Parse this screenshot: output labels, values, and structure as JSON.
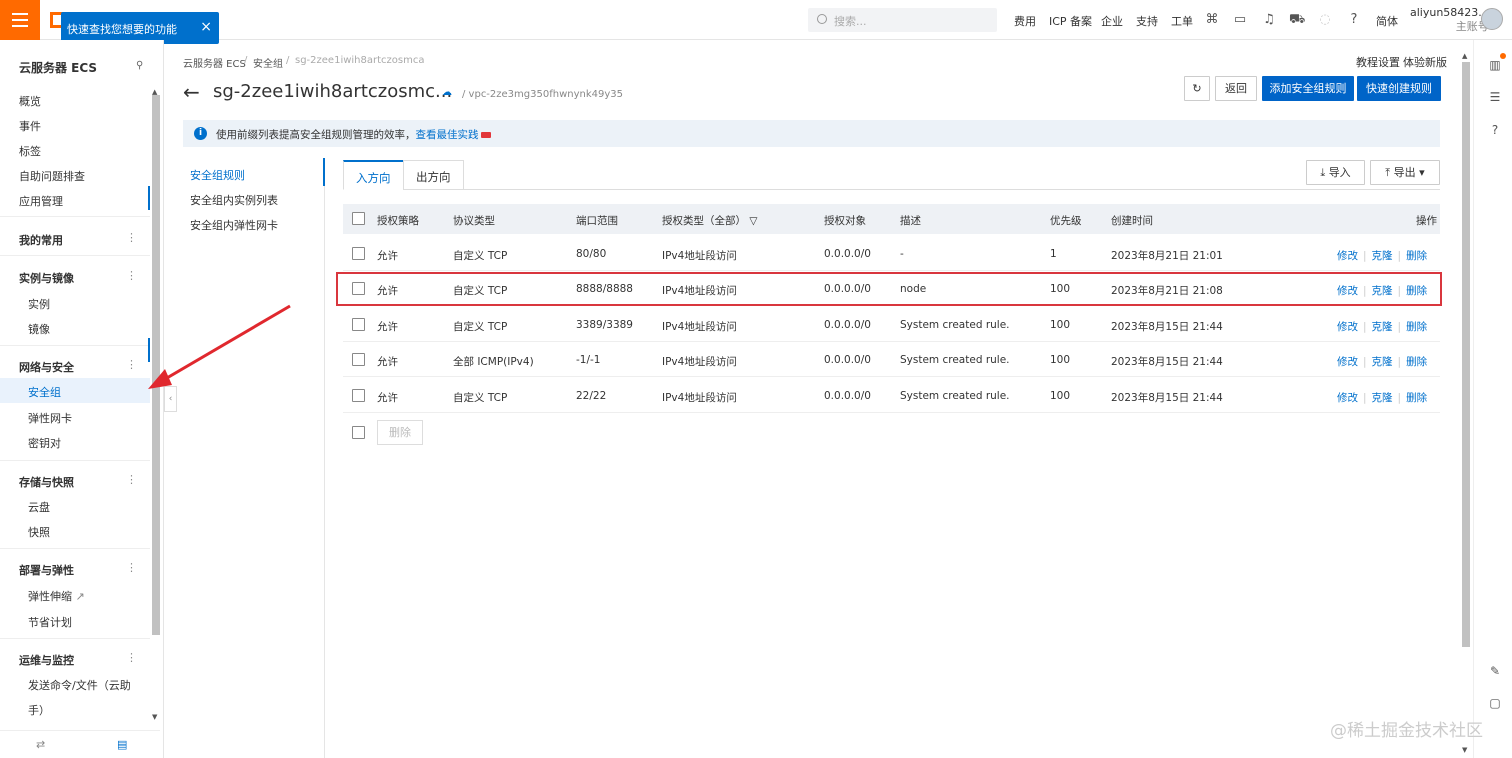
{
  "topbar": {
    "tooltip": "快速查找您想要的功能",
    "tooltip_close": "×",
    "search_placeholder": "搜索...",
    "links": [
      "费用",
      "ICP 备案",
      "企业",
      "支持",
      "工单"
    ],
    "lang": "简体",
    "user_name": "aliyun58423...",
    "user_role": "主账号"
  },
  "sidebar": {
    "title": "云服务器 ECS",
    "items": [
      {
        "label": "概览"
      },
      {
        "label": "事件"
      },
      {
        "label": "标签"
      },
      {
        "label": "自助问题排查"
      },
      {
        "label": "应用管理"
      }
    ],
    "favorites": "我的常用",
    "group_instances": "实例与镜像",
    "instance": "实例",
    "image": "镜像",
    "group_network": "网络与安全",
    "security_group": "安全组",
    "eni": "弹性网卡",
    "keypair": "密钥对",
    "group_storage": "存储与快照",
    "disk": "云盘",
    "snapshot": "快照",
    "group_deploy": "部署与弹性",
    "autoscaling": "弹性伸缩",
    "savings": "节省计划",
    "group_ops": "运维与监控",
    "send_cmd": "发送命令/文件（云助",
    "send_cmd_2": "手）"
  },
  "breadcrumb": {
    "c1": "云服务器 ECS",
    "sep": "/",
    "c2": "安全组",
    "c3": "sg-2zee1iwih8artczosmca"
  },
  "header": {
    "tutorial": "教程设置",
    "new_version": "体验新版",
    "title": "sg-2zee1iwih8artczosmc...",
    "vpc": "/ vpc-2ze3mg350fhwnynk49y35",
    "back_btn": "返回",
    "add_rule_btn": "添加安全组规则",
    "quick_rule_btn": "快速创建规则"
  },
  "notice": {
    "text": "使用前缀列表提高安全组规则管理的效率，",
    "link": "查看最佳实践"
  },
  "subnav": [
    "安全组规则",
    "安全组内实例列表",
    "安全组内弹性网卡"
  ],
  "tabs": {
    "inbound": "入方向",
    "outbound": "出方向",
    "import": "导入",
    "export": "导出"
  },
  "table": {
    "headers": {
      "policy": "授权策略",
      "protocol": "协议类型",
      "port": "端口范围",
      "auth_type": "授权类型（全部）",
      "auth_obj": "授权对象",
      "desc": "描述",
      "priority": "优先级",
      "created": "创建时间",
      "ops": "操作"
    },
    "rows": [
      {
        "policy": "允许",
        "protocol": "自定义 TCP",
        "port": "80/80",
        "auth_type": "IPv4地址段访问",
        "auth_obj": "0.0.0.0/0",
        "desc": "-",
        "priority": "1",
        "created": "2023年8月21日 21:01"
      },
      {
        "policy": "允许",
        "protocol": "自定义 TCP",
        "port": "8888/8888",
        "auth_type": "IPv4地址段访问",
        "auth_obj": "0.0.0.0/0",
        "desc": "node",
        "priority": "100",
        "created": "2023年8月21日 21:08"
      },
      {
        "policy": "允许",
        "protocol": "自定义 TCP",
        "port": "3389/3389",
        "auth_type": "IPv4地址段访问",
        "auth_obj": "0.0.0.0/0",
        "desc": "System created rule.",
        "priority": "100",
        "created": "2023年8月15日 21:44"
      },
      {
        "policy": "允许",
        "protocol": "全部 ICMP(IPv4)",
        "port": "-1/-1",
        "auth_type": "IPv4地址段访问",
        "auth_obj": "0.0.0.0/0",
        "desc": "System created rule.",
        "priority": "100",
        "created": "2023年8月15日 21:44"
      },
      {
        "policy": "允许",
        "protocol": "自定义 TCP",
        "port": "22/22",
        "auth_type": "IPv4地址段访问",
        "auth_obj": "0.0.0.0/0",
        "desc": "System created rule.",
        "priority": "100",
        "created": "2023年8月15日 21:44"
      }
    ],
    "op_edit": "修改",
    "op_clone": "克隆",
    "op_delete": "删除",
    "bulk_delete": "删除"
  },
  "watermark": "@稀土掘金技术社区",
  "colors": {
    "accent": "#0070cc",
    "brand": "#ff6a00",
    "highlight": "#d9363e"
  }
}
